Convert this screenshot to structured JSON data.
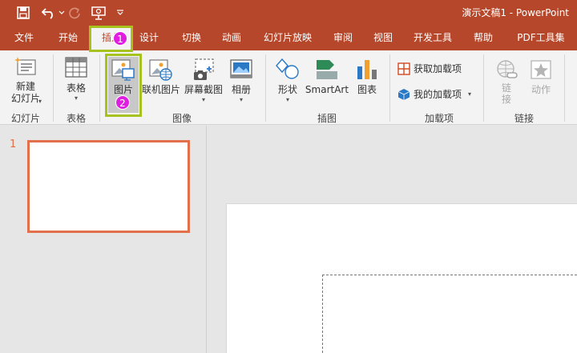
{
  "window": {
    "title": "演示文稿1  -  PowerPoint"
  },
  "tabs": [
    "文件",
    "开始",
    "插入",
    "设计",
    "切换",
    "动画",
    "幻灯片放映",
    "审阅",
    "视图",
    "开发工具",
    "帮助",
    "PDF工具集"
  ],
  "active_tab": "插入",
  "ribbon": {
    "slides": {
      "new_slide": "新建\n幻灯片",
      "group": "幻灯片"
    },
    "tables": {
      "table": "表格",
      "group": "表格"
    },
    "images": {
      "picture": "图片",
      "online_picture": "联机图片",
      "screenshot": "屏幕截图",
      "album": "相册",
      "group": "图像"
    },
    "illustrations": {
      "shapes": "形状",
      "smartart": "SmartArt",
      "chart": "图表",
      "group": "插图"
    },
    "addins": {
      "get_addins": "获取加载项",
      "my_addins": "我的加载项",
      "group": "加载项"
    },
    "links": {
      "link": "链\n接",
      "action": "动作",
      "group": "链接"
    }
  },
  "annotations": {
    "step1": "1",
    "step2": "2"
  },
  "slides_pane": {
    "slide_number": "1"
  },
  "colors": {
    "accent": "#b7472a",
    "highlight": "#a6c21e",
    "badge": "#e01ee0",
    "thumb_border": "#e2704a"
  }
}
